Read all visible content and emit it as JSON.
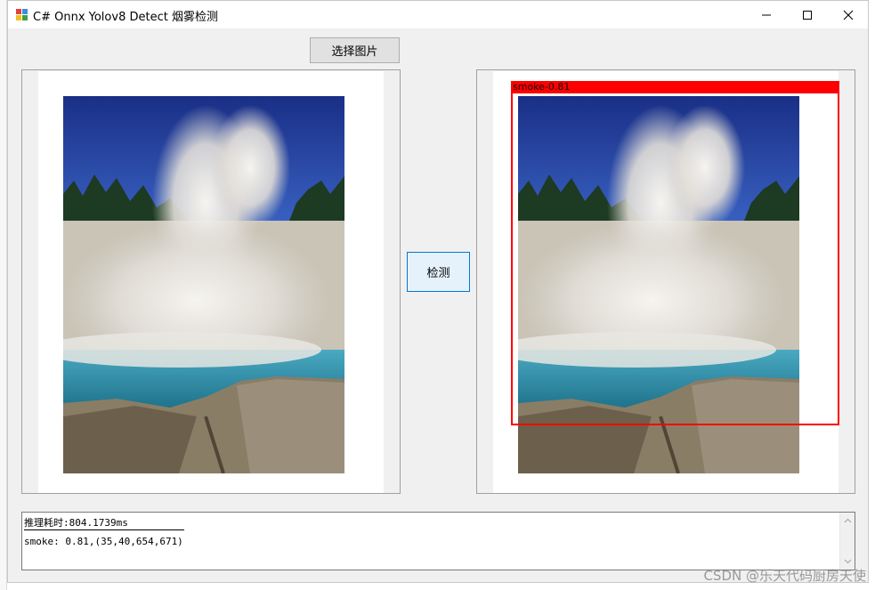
{
  "window": {
    "title": "C# Onnx Yolov8 Detect 烟雾检测",
    "controls": [
      "minimize",
      "maximize",
      "close"
    ]
  },
  "toolbar": {
    "select_image_label": "选择图片",
    "detect_label": "检测"
  },
  "detection": {
    "box_label": "smoke-0.81"
  },
  "output": {
    "inference_time": "推理耗时:804.1739ms",
    "result_line": "smoke: 0.81,(35,40,654,671)"
  },
  "watermark": "CSDN @乐天代码厨房天使",
  "colors": {
    "window_bg": "#f0f0f0",
    "detect_box": "#ff0000",
    "focus_border": "#0078d7"
  }
}
